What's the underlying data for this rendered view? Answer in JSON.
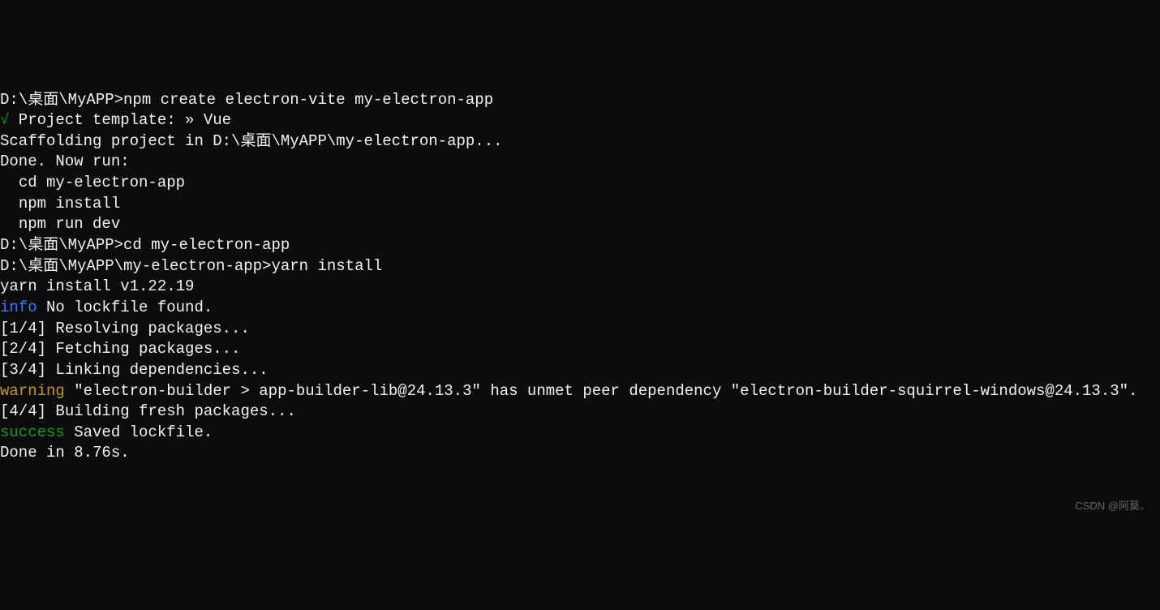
{
  "terminal": {
    "prompt1_path": "D:\\桌面\\MyAPP>",
    "prompt1_cmd": "npm create electron-vite my-electron-app",
    "checkmark": "√",
    "template_label": " Project template: ",
    "template_arrow": "»",
    "template_value": " Vue",
    "blank": "",
    "scaffold": "Scaffolding project in D:\\桌面\\MyAPP\\my-electron-app...",
    "done_run": "Done. Now run:",
    "cd_cmd": "  cd my-electron-app",
    "npm_install": "  npm install",
    "npm_dev": "  npm run dev",
    "prompt2_path": "D:\\桌面\\MyAPP>",
    "prompt2_cmd": "cd my-electron-app",
    "prompt3_path": "D:\\桌面\\MyAPP\\my-electron-app>",
    "prompt3_cmd": "yarn install",
    "yarn_version": "yarn install v1.22.19",
    "info_label": "info",
    "info_text": " No lockfile found.",
    "step1": "[1/4] Resolving packages...",
    "step2": "[2/4] Fetching packages...",
    "step3": "[3/4] Linking dependencies...",
    "warning_label": "warning",
    "warning_text": " \"electron-builder > app-builder-lib@24.13.3\" has unmet peer dependency \"electron-builder-squirrel-windows@24.13.3\".",
    "step4": "[4/4] Building fresh packages...",
    "success_label": "success",
    "success_text": " Saved lockfile.",
    "done_time": "Done in 8.76s."
  },
  "watermark": "CSDN @阿莫、"
}
